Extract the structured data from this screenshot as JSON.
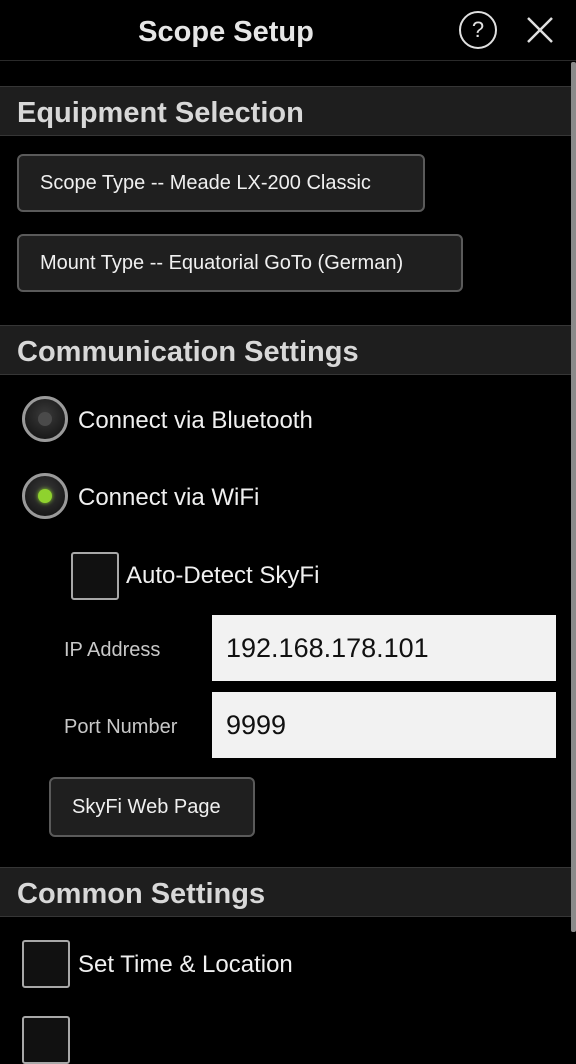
{
  "header": {
    "title": "Scope Setup",
    "help_icon_text": "?",
    "close_icon": "close-icon"
  },
  "equipment": {
    "heading": "Equipment Selection",
    "scope_type_label": "Scope Type -- Meade LX-200 Classic",
    "mount_type_label": "Mount Type -- Equatorial GoTo (German)"
  },
  "communication": {
    "heading": "Communication Settings",
    "bluetooth_label": "Connect via Bluetooth",
    "bluetooth_selected": false,
    "wifi_label": "Connect via WiFi",
    "wifi_selected": true,
    "auto_detect_label": "Auto-Detect SkyFi",
    "auto_detect_checked": false,
    "ip_label": "IP Address",
    "ip_value": "192.168.178.101",
    "port_label": "Port Number",
    "port_value": "9999",
    "web_page_button": "SkyFi Web Page"
  },
  "common": {
    "heading": "Common Settings",
    "set_time_label": "Set Time & Location",
    "set_time_checked": false
  },
  "colors": {
    "radio_selected": "#8fd22e",
    "section_bg": "#1e1e1e",
    "background": "#000000"
  }
}
